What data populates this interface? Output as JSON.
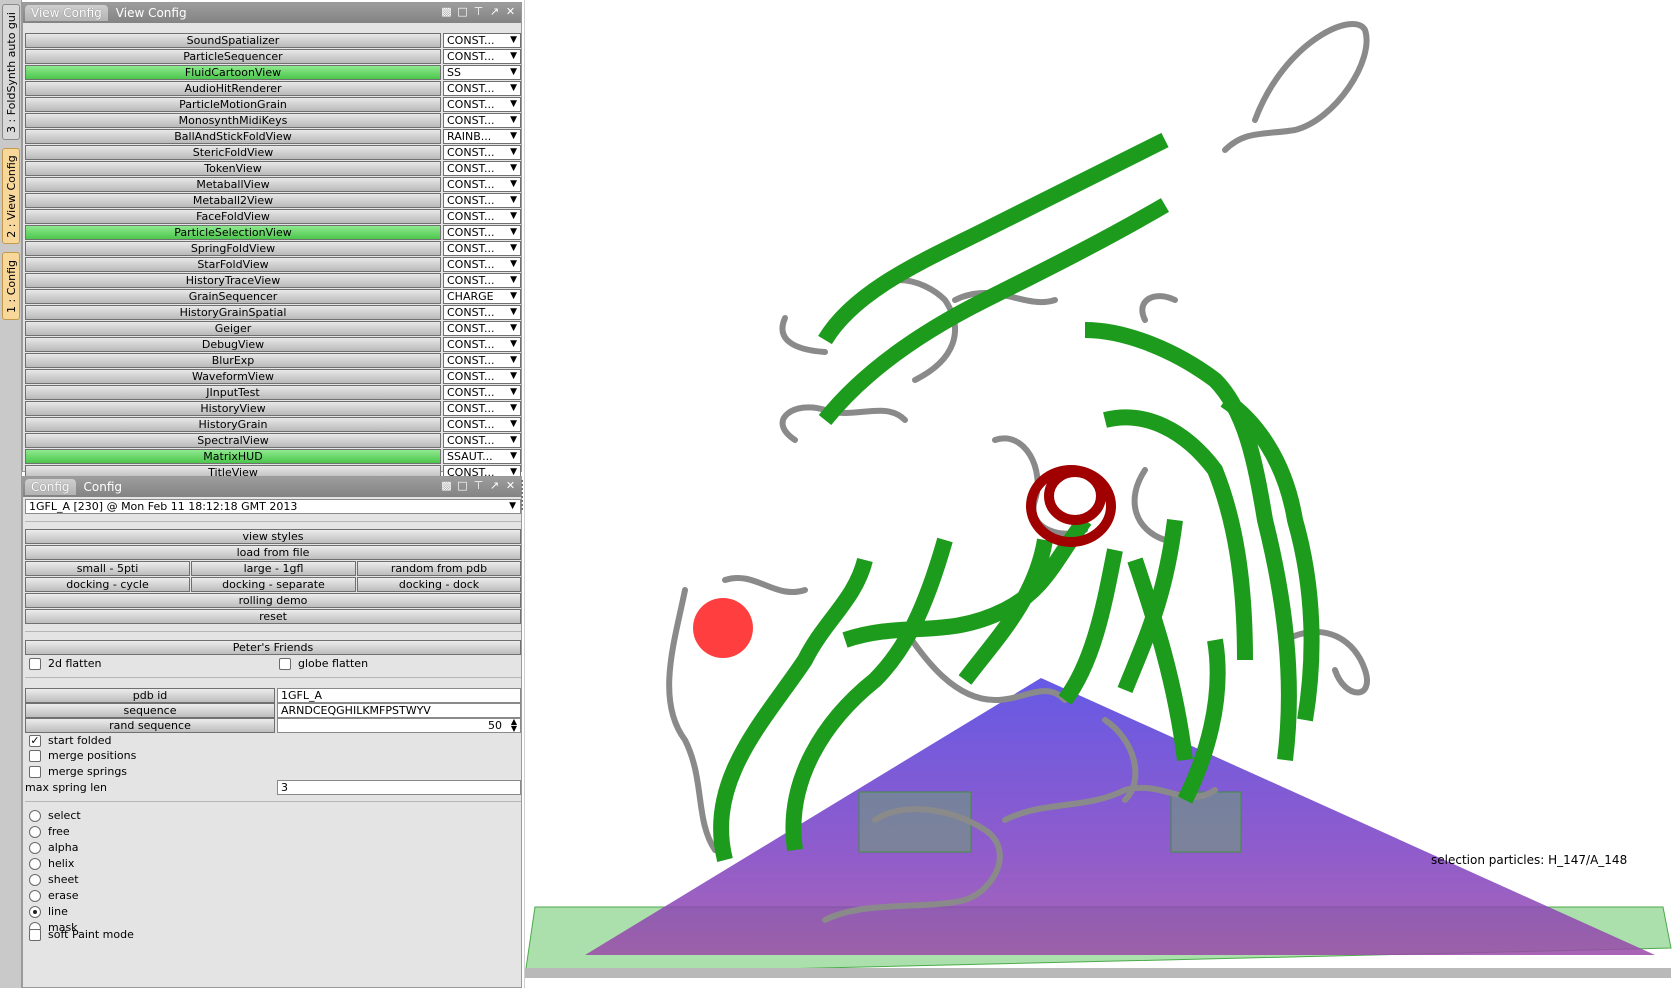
{
  "side_tabs": [
    {
      "label": "3 : FoldSynth auto gui",
      "active": false
    },
    {
      "label": "2 : View Config",
      "active": true
    },
    {
      "label": "1 : Config",
      "active": true
    }
  ],
  "view_config": {
    "tab_label": "View Config",
    "title": "View Config",
    "items": [
      {
        "name": "SoundSpatializer",
        "mode": "CONST...",
        "on": false
      },
      {
        "name": "ParticleSequencer",
        "mode": "CONST...",
        "on": false
      },
      {
        "name": "FluidCartoonView",
        "mode": "SS",
        "on": true
      },
      {
        "name": "AudioHitRenderer",
        "mode": "CONST...",
        "on": false
      },
      {
        "name": "ParticleMotionGrain",
        "mode": "CONST...",
        "on": false
      },
      {
        "name": "MonosynthMidiKeys",
        "mode": "CONST...",
        "on": false
      },
      {
        "name": "BallAndStickFoldView",
        "mode": "RAINB...",
        "on": false
      },
      {
        "name": "StericFoldView",
        "mode": "CONST...",
        "on": false
      },
      {
        "name": "TokenView",
        "mode": "CONST...",
        "on": false
      },
      {
        "name": "MetaballView",
        "mode": "CONST...",
        "on": false
      },
      {
        "name": "Metaball2View",
        "mode": "CONST...",
        "on": false
      },
      {
        "name": "FaceFoldView",
        "mode": "CONST...",
        "on": false
      },
      {
        "name": "ParticleSelectionView",
        "mode": "CONST...",
        "on": true
      },
      {
        "name": "SpringFoldView",
        "mode": "CONST...",
        "on": false
      },
      {
        "name": "StarFoldView",
        "mode": "CONST...",
        "on": false
      },
      {
        "name": "HistoryTraceView",
        "mode": "CONST...",
        "on": false
      },
      {
        "name": "GrainSequencer",
        "mode": "CHARGE",
        "on": false
      },
      {
        "name": "HistoryGrainSpatial",
        "mode": "CONST...",
        "on": false
      },
      {
        "name": "Geiger",
        "mode": "CONST...",
        "on": false
      },
      {
        "name": "DebugView",
        "mode": "CONST...",
        "on": false
      },
      {
        "name": "BlurExp",
        "mode": "CONST...",
        "on": false
      },
      {
        "name": "WaveformView",
        "mode": "CONST...",
        "on": false
      },
      {
        "name": "JInputTest",
        "mode": "CONST...",
        "on": false
      },
      {
        "name": "HistoryView",
        "mode": "CONST...",
        "on": false
      },
      {
        "name": "HistoryGrain",
        "mode": "CONST...",
        "on": false
      },
      {
        "name": "SpectralView",
        "mode": "CONST...",
        "on": false
      },
      {
        "name": "MatrixHUD",
        "mode": "SSAUT...",
        "on": true
      },
      {
        "name": "TitleView",
        "mode": "CONST...",
        "on": false
      }
    ]
  },
  "config": {
    "tab_label": "Config",
    "title": "Config",
    "session": "1GFL_A [230] @ Mon Feb 11 18:12:18 GMT 2013",
    "buttons": {
      "view_styles": "view styles",
      "load_from_file": "load from file",
      "small": "small - 5pti",
      "large": "large - 1gfl",
      "random_pdb": "random from pdb",
      "dock_cycle": "docking - cycle",
      "dock_separate": "docking - separate",
      "dock_dock": "docking - dock",
      "rolling_demo": "rolling demo",
      "reset": "reset",
      "peters_friends": "Peter's Friends",
      "pdb_id": "pdb id",
      "sequence": "sequence",
      "rand_sequence": "rand sequence"
    },
    "flatten_2d": "2d flatten",
    "globe_flatten": "globe flatten",
    "pdb_id_value": "1GFL_A",
    "sequence_value": "ARNDCEQGHILKMFPSTWYV",
    "rand_sequence_value": "50",
    "start_folded": "start folded",
    "merge_positions": "merge positions",
    "merge_springs": "merge springs",
    "max_spring_len_label": "max spring len",
    "max_spring_len_value": "3",
    "paint_modes": [
      {
        "label": "select",
        "selected": false
      },
      {
        "label": "free",
        "selected": false
      },
      {
        "label": "alpha",
        "selected": false
      },
      {
        "label": "helix",
        "selected": false
      },
      {
        "label": "sheet",
        "selected": false
      },
      {
        "label": "erase",
        "selected": false
      },
      {
        "label": "line",
        "selected": true
      },
      {
        "label": "mask",
        "selected": false
      }
    ],
    "soft_paint": "soft Paint mode"
  },
  "viewport": {
    "selection_text": "selection particles: H_147/A_148",
    "colors": {
      "sheet": "#1d9b1d",
      "coil": "#8a8a8a",
      "helix": "#a00000",
      "marker": "#ff2a2a",
      "plane": "#6a3cd0"
    }
  }
}
